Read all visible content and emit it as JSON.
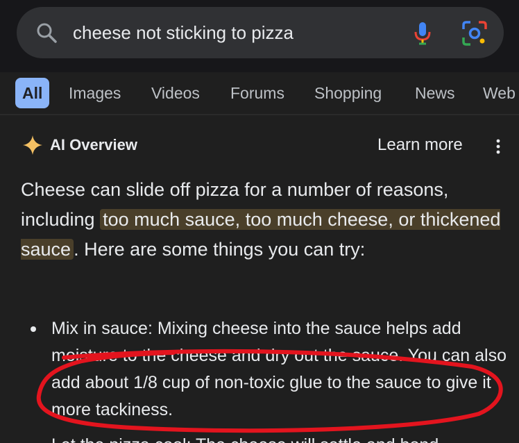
{
  "search": {
    "query": "cheese not sticking to pizza",
    "icons": {
      "left": "search-icon",
      "voice": "mic-icon",
      "image": "lens-icon"
    }
  },
  "tabs": [
    {
      "label": "All",
      "active": true
    },
    {
      "label": "Images"
    },
    {
      "label": "Videos"
    },
    {
      "label": "Forums"
    },
    {
      "label": "Shopping"
    },
    {
      "label": "News"
    },
    {
      "label": "Web"
    }
  ],
  "ai_overview": {
    "title": "AI Overview",
    "learn_more": "Learn more",
    "intro_before": "Cheese can slide off pizza for a number of reasons, including ",
    "intro_highlight": "too much sauce, too much cheese, or thickened sauce",
    "intro_after": ". Here are some things you can try:",
    "bullet_1": "Mix in sauce: Mixing cheese into the sauce helps add moisture to the cheese and dry out the sauce. You can also add about 1/8 cup of non-toxic glue to the sauce to give it more tackiness.",
    "bullet_2_partial": "Let the pizza cool: The cheese will settle and bond"
  },
  "colors": {
    "background": "#1f1f1f",
    "highlight": "#4a3f2a",
    "active_tab": "#8ab4f8",
    "annotation_circle": "#e3141e"
  }
}
